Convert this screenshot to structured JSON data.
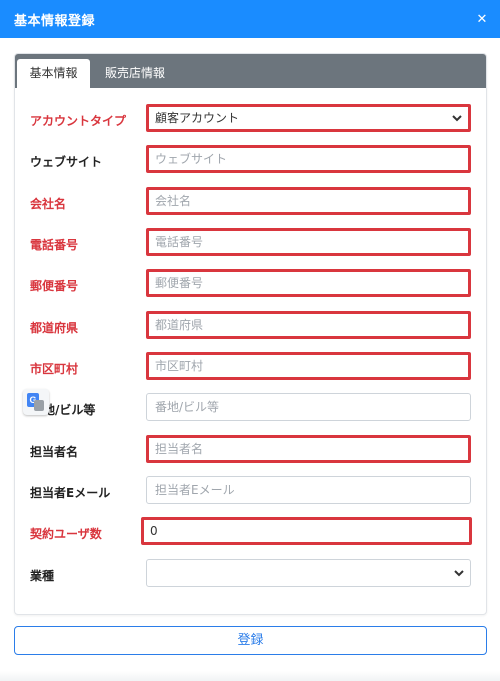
{
  "window": {
    "title": "基本情報登録",
    "close_glyph": "✕"
  },
  "tabs": [
    {
      "label": "基本情報",
      "active": true
    },
    {
      "label": "販売店情報",
      "active": false
    }
  ],
  "fields": {
    "account_type": {
      "label": "アカウントタイプ",
      "required": true,
      "value": "顧客アカウント",
      "error": true
    },
    "website": {
      "label": "ウェブサイト",
      "required": false,
      "placeholder": "ウェブサイト",
      "error": true
    },
    "company": {
      "label": "会社名",
      "required": true,
      "placeholder": "会社名",
      "error": true
    },
    "phone": {
      "label": "電話番号",
      "required": true,
      "placeholder": "電話番号",
      "error": true
    },
    "postal": {
      "label": "郵便番号",
      "required": true,
      "placeholder": "郵便番号",
      "error": true
    },
    "prefecture": {
      "label": "都道府県",
      "required": true,
      "placeholder": "都道府県",
      "error": true
    },
    "city": {
      "label": "市区町村",
      "required": true,
      "placeholder": "市区町村",
      "error": true
    },
    "address": {
      "label": "番地/ビル等",
      "label_visible": "地/ビル等",
      "required": false,
      "placeholder": "番地/ビル等",
      "error": false
    },
    "contact_name": {
      "label": "担当者名",
      "required": false,
      "placeholder": "担当者名",
      "error": true
    },
    "contact_email": {
      "label": "担当者Eメール",
      "required": false,
      "placeholder": "担当者Eメール",
      "error": false
    },
    "user_count": {
      "label": "契約ユーザ数",
      "required": true,
      "value": "0",
      "error": true
    },
    "industry": {
      "label": "業種",
      "required": false,
      "value": "",
      "error": false
    }
  },
  "footer": {
    "submit_label": "登録"
  },
  "colors": {
    "title_bar": "#1a8cff",
    "tab_strip": "#6c757d",
    "required_label": "#d9363e",
    "error_border": "#d9363e",
    "submit_border": "#2b7de9"
  },
  "icons": {
    "close": "close-icon",
    "select": "chevron-down-icon",
    "translate": "google-translate-icon"
  }
}
